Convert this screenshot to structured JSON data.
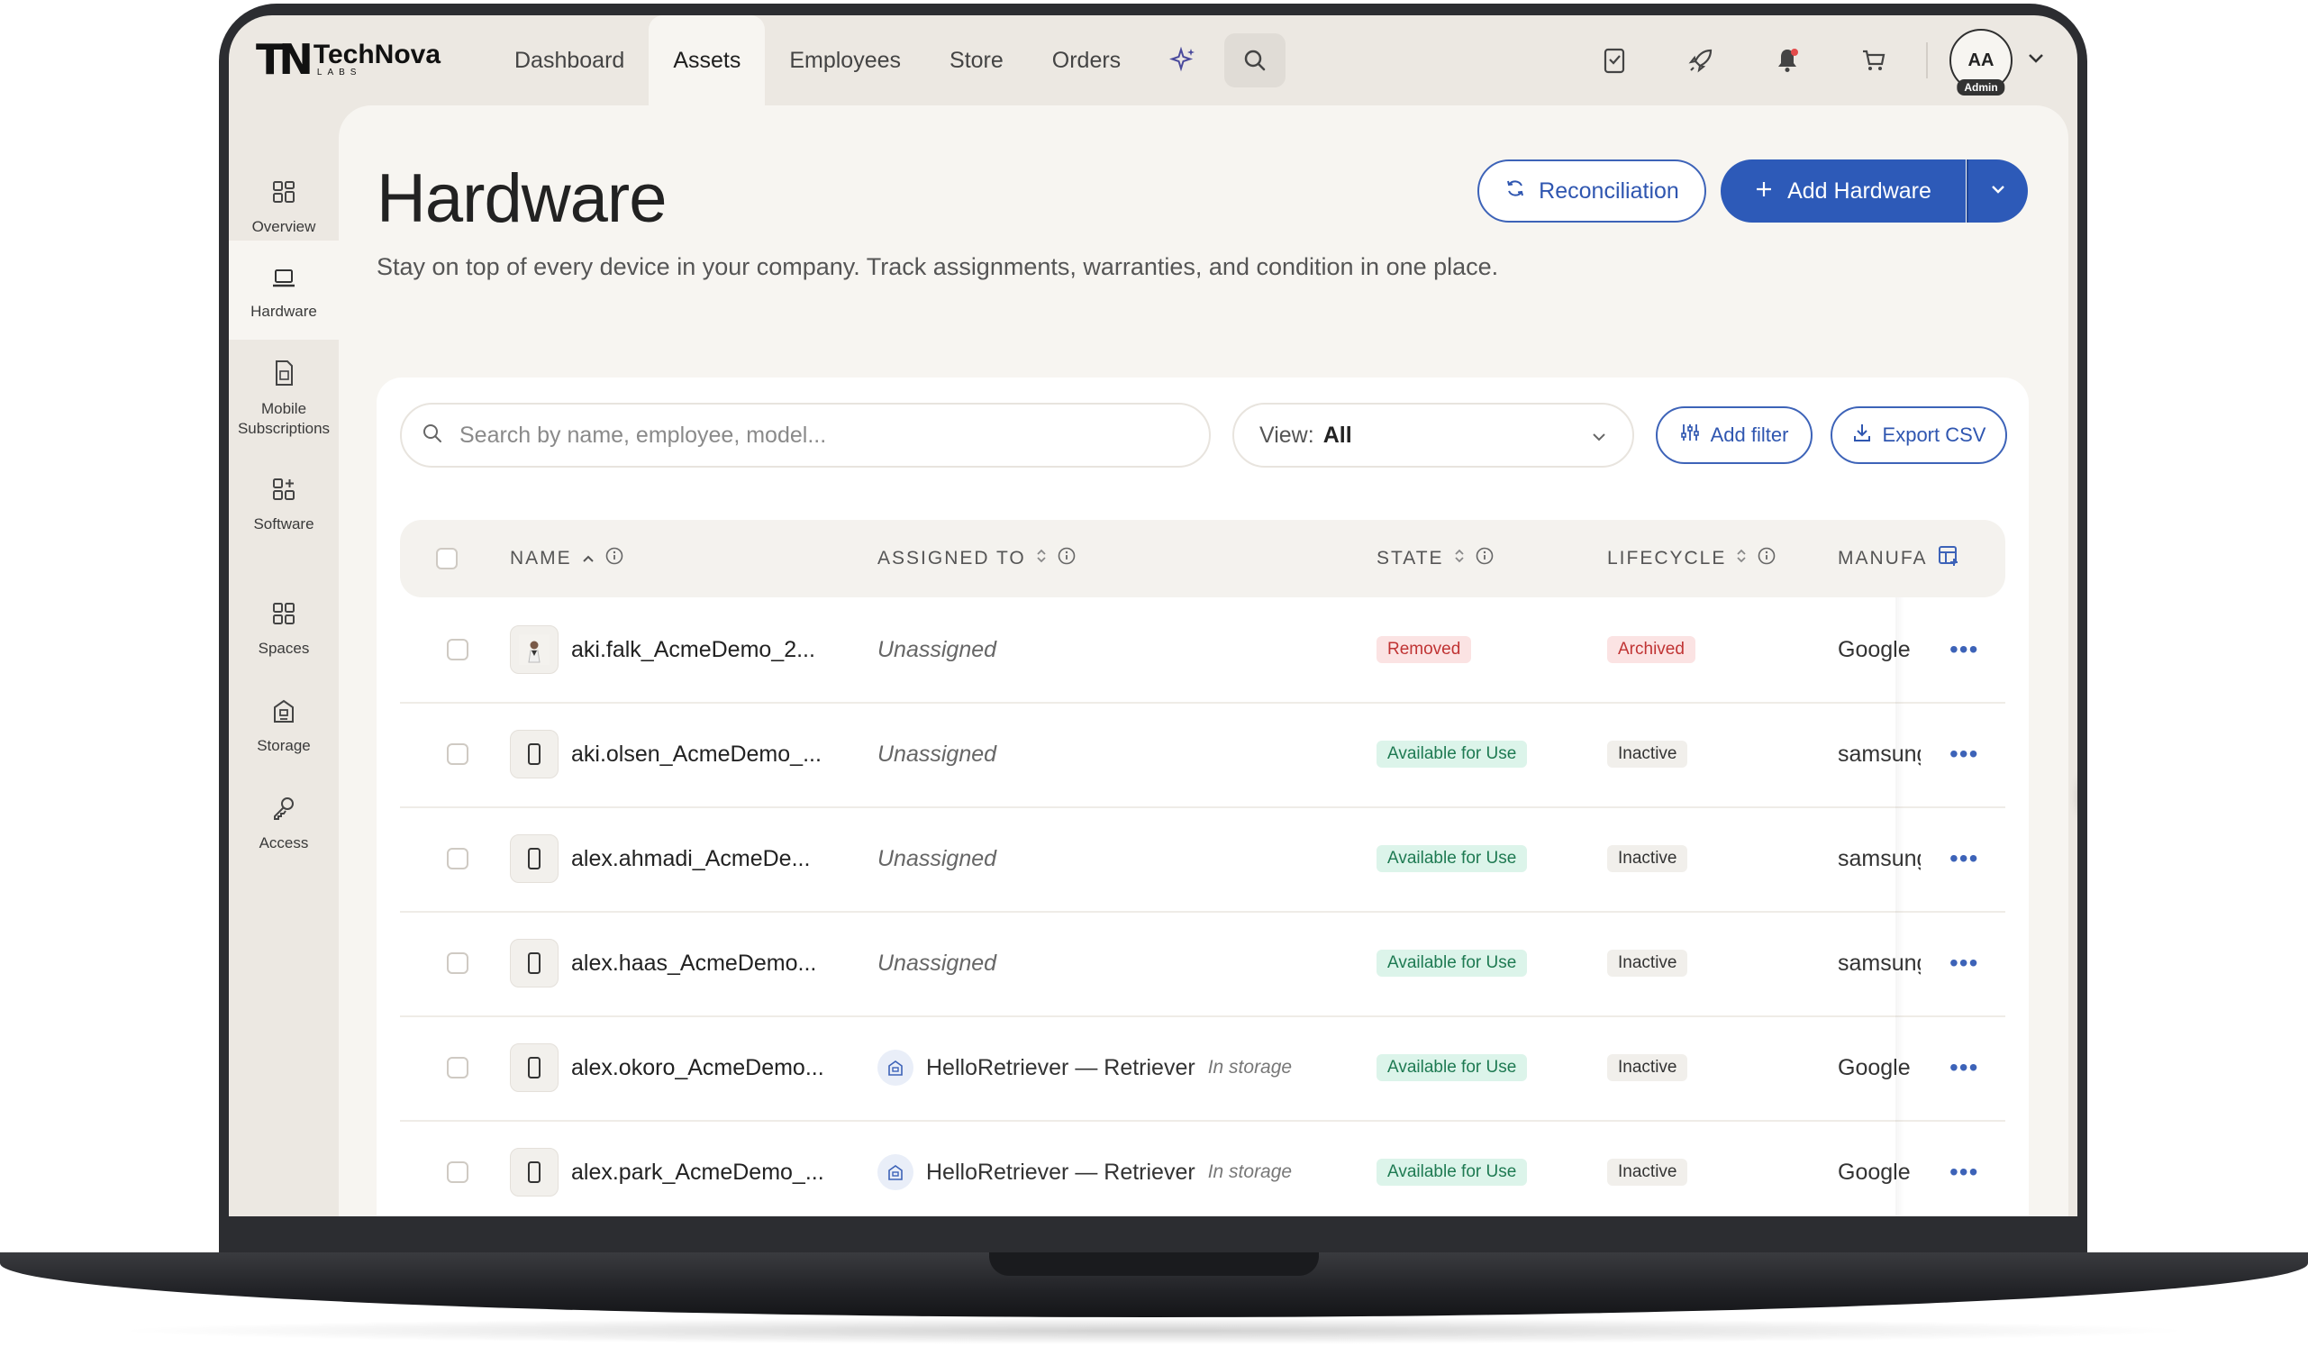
{
  "app": {
    "logo_mark": "TN",
    "logo_name": "TechNova",
    "logo_sub": "LABS"
  },
  "nav": {
    "items": [
      "Dashboard",
      "Assets",
      "Employees",
      "Store",
      "Orders"
    ],
    "active": "Assets",
    "sparkle_icon": "sparkle-icon",
    "search_icon": "search-icon"
  },
  "user": {
    "initials": "AA",
    "role": "Admin"
  },
  "sidebar": {
    "items": [
      {
        "label": "Overview",
        "icon": "grid-icon"
      },
      {
        "label": "Hardware",
        "icon": "laptop-icon"
      },
      {
        "label": "Mobile Subscriptions",
        "icon": "sim-icon"
      },
      {
        "label": "Software",
        "icon": "apps-icon"
      },
      {
        "label": "Spaces",
        "icon": "grid-icon"
      },
      {
        "label": "Storage",
        "icon": "building-icon"
      },
      {
        "label": "Access",
        "icon": "key-icon"
      }
    ],
    "active": "Hardware"
  },
  "page": {
    "title": "Hardware",
    "description": "Stay on top of every device in your company. Track assignments, warranties, and condition in one place."
  },
  "actions": {
    "reconciliation": "Reconciliation",
    "add_hardware": "Add Hardware"
  },
  "toolbar": {
    "search_placeholder": "Search by name, employee, model...",
    "view_label": "View:",
    "view_value": "All",
    "add_filter": "Add filter",
    "export_csv": "Export CSV"
  },
  "table": {
    "columns": [
      "NAME",
      "ASSIGNED TO",
      "STATE",
      "LIFECYCLE",
      "MANUFA"
    ],
    "rows": [
      {
        "name": "aki.falk_AcmeDemo_2...",
        "assigned": "Unassigned",
        "assigned_type": "none",
        "state": "Removed",
        "lifecycle": "Archived",
        "manufacturer": "Google"
      },
      {
        "name": "aki.olsen_AcmeDemo_...",
        "assigned": "Unassigned",
        "assigned_type": "none",
        "state": "Available for Use",
        "lifecycle": "Inactive",
        "manufacturer": "samsung"
      },
      {
        "name": "alex.ahmadi_AcmeDe...",
        "assigned": "Unassigned",
        "assigned_type": "none",
        "state": "Available for Use",
        "lifecycle": "Inactive",
        "manufacturer": "samsung"
      },
      {
        "name": "alex.haas_AcmeDemo...",
        "assigned": "Unassigned",
        "assigned_type": "none",
        "state": "Available for Use",
        "lifecycle": "Inactive",
        "manufacturer": "samsung"
      },
      {
        "name": "alex.okoro_AcmeDemo...",
        "assigned": "HelloRetriever — Retriever",
        "assigned_type": "storage",
        "storage_note": "In storage",
        "state": "Available for Use",
        "lifecycle": "Inactive",
        "manufacturer": "Google"
      },
      {
        "name": "alex.park_AcmeDemo_...",
        "assigned": "HelloRetriever — Retriever",
        "assigned_type": "storage",
        "storage_note": "In storage",
        "state": "Available for Use",
        "lifecycle": "Inactive",
        "manufacturer": "Google"
      }
    ]
  },
  "colors": {
    "accent": "#2d5ab8",
    "removed": "#c03434",
    "available": "#1e7a52",
    "notification": "#e34b4b"
  }
}
